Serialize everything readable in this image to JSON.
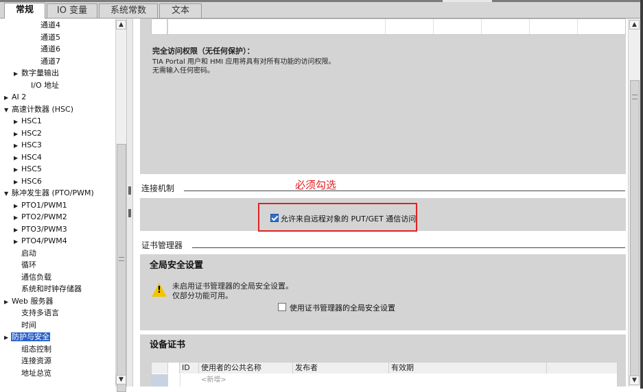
{
  "tabs": [
    {
      "label": "常规",
      "active": true
    },
    {
      "label": "IO 变量",
      "active": false
    },
    {
      "label": "系统常数",
      "active": false
    },
    {
      "label": "文本",
      "active": false
    }
  ],
  "tree": [
    {
      "label": "通道4",
      "expander": ""
    },
    {
      "label": "通道5",
      "expander": ""
    },
    {
      "label": "通道6",
      "expander": ""
    },
    {
      "label": "通道7",
      "expander": ""
    },
    {
      "label": "数字量输出",
      "expander": "▶"
    },
    {
      "label": "I/O 地址",
      "expander": ""
    },
    {
      "label": "AI 2",
      "expander": "▶"
    },
    {
      "label": "高速计数器 (HSC)",
      "expander": "▼"
    },
    {
      "label": "HSC1",
      "expander": "▶"
    },
    {
      "label": "HSC2",
      "expander": "▶"
    },
    {
      "label": "HSC3",
      "expander": "▶"
    },
    {
      "label": "HSC4",
      "expander": "▶"
    },
    {
      "label": "HSC5",
      "expander": "▶"
    },
    {
      "label": "HSC6",
      "expander": "▶"
    },
    {
      "label": "脉冲发生器 (PTO/PWM)",
      "expander": "▼"
    },
    {
      "label": "PTO1/PWM1",
      "expander": "▶"
    },
    {
      "label": "PTO2/PWM2",
      "expander": "▶"
    },
    {
      "label": "PTO3/PWM3",
      "expander": "▶"
    },
    {
      "label": "PTO4/PWM4",
      "expander": "▶"
    },
    {
      "label": "启动",
      "expander": ""
    },
    {
      "label": "循环",
      "expander": ""
    },
    {
      "label": "通信负载",
      "expander": ""
    },
    {
      "label": "系统和时钟存储器",
      "expander": ""
    },
    {
      "label": "Web 服务器",
      "expander": "▶"
    },
    {
      "label": "支持多语言",
      "expander": ""
    },
    {
      "label": "时间",
      "expander": ""
    },
    {
      "label": "防护与安全",
      "expander": "▶",
      "selected": true
    },
    {
      "label": "组态控制",
      "expander": ""
    },
    {
      "label": "连接资源",
      "expander": ""
    },
    {
      "label": "地址总览",
      "expander": ""
    }
  ],
  "access": {
    "title": "完全访问权限（无任何保护）：",
    "line1": "TIA Portal 用户和 HMI 应用将具有对所有功能的访问权限。",
    "line2": "无需输入任何密码。"
  },
  "connection": {
    "heading": "连接机制",
    "note": "必须勾选",
    "checkbox_label": "允许来自远程对象的 PUT/GET 通信访问",
    "checked": true
  },
  "cert_manager": {
    "heading": "证书管理器",
    "global_title": "全局安全设置",
    "warn_line1": "未启用证书管理器的全局安全设置。",
    "warn_line2": "仅部分功能可用。",
    "checkbox_label": "使用证书管理器的全局安全设置",
    "checked": false
  },
  "device_cert": {
    "title": "设备证书",
    "columns": [
      "ID",
      "使用者的公共名称",
      "发布者",
      "有效期"
    ],
    "new_row": "<新增>"
  },
  "colors": {
    "selection": "#2b63c9",
    "annotation": "#e02020",
    "panel": "#d4d4d4"
  }
}
